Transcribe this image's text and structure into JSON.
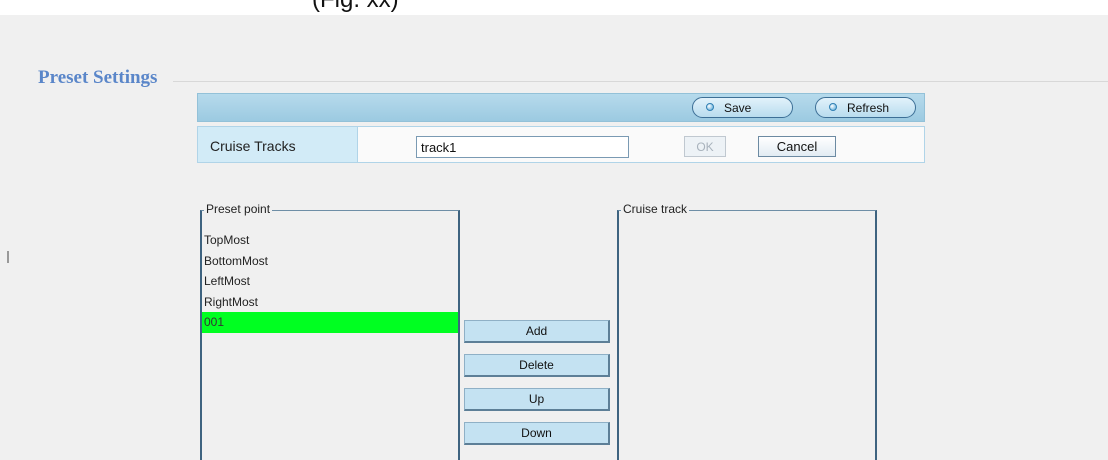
{
  "header": {
    "partial_text": "(Fig. xx)",
    "page_title": "Preset Settings"
  },
  "toolbar": {
    "save_label": "Save",
    "refresh_label": "Refresh"
  },
  "cruise": {
    "label": "Cruise Tracks",
    "track_name": "track1",
    "ok_label": "OK",
    "cancel_label": "Cancel"
  },
  "preset_point": {
    "legend": "Preset point",
    "items": [
      "TopMost",
      "BottomMost",
      "LeftMost",
      "RightMost",
      "001"
    ],
    "selected": "001",
    "selected_color": "#00ff21"
  },
  "actions": {
    "add": "Add",
    "delete": "Delete",
    "up": "Up",
    "down": "Down"
  },
  "cruise_track": {
    "legend": "Cruise track",
    "items": []
  },
  "colors": {
    "title": "#5a86c9",
    "toolbar": "#b6daec",
    "label_cell": "#d2ebf7"
  }
}
